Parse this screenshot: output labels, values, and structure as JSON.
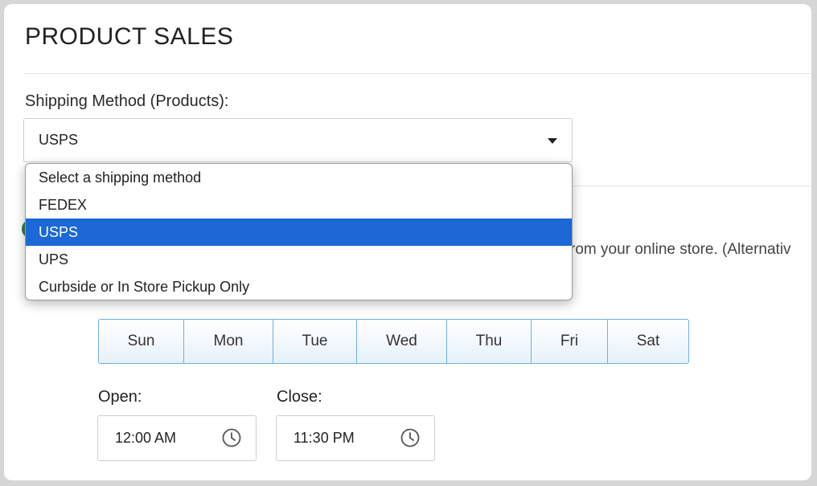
{
  "page": {
    "title": "PRODUCT SALES"
  },
  "shipping": {
    "label": "Shipping Method (Products):",
    "selected": "USPS",
    "options": [
      "Select a shipping method",
      "FEDEX",
      "USPS",
      "UPS",
      "Curbside or In Store Pickup Only"
    ],
    "selected_index": 2
  },
  "description": {
    "partial_text": "rom your online store. (Alternativ"
  },
  "days": [
    "Sun",
    "Mon",
    "Tue",
    "Wed",
    "Thu",
    "Fri",
    "Sat"
  ],
  "hours": {
    "open_label": "Open:",
    "open_value": "12:00 AM",
    "close_label": "Close:",
    "close_value": "11:30 PM"
  },
  "colors": {
    "selection": "#1b68d6",
    "day_border": "#6fb0e3",
    "toggle_green": "#2e7d4a"
  },
  "icons": {
    "clock": "clock-icon",
    "caret": "chevron-down-icon"
  }
}
